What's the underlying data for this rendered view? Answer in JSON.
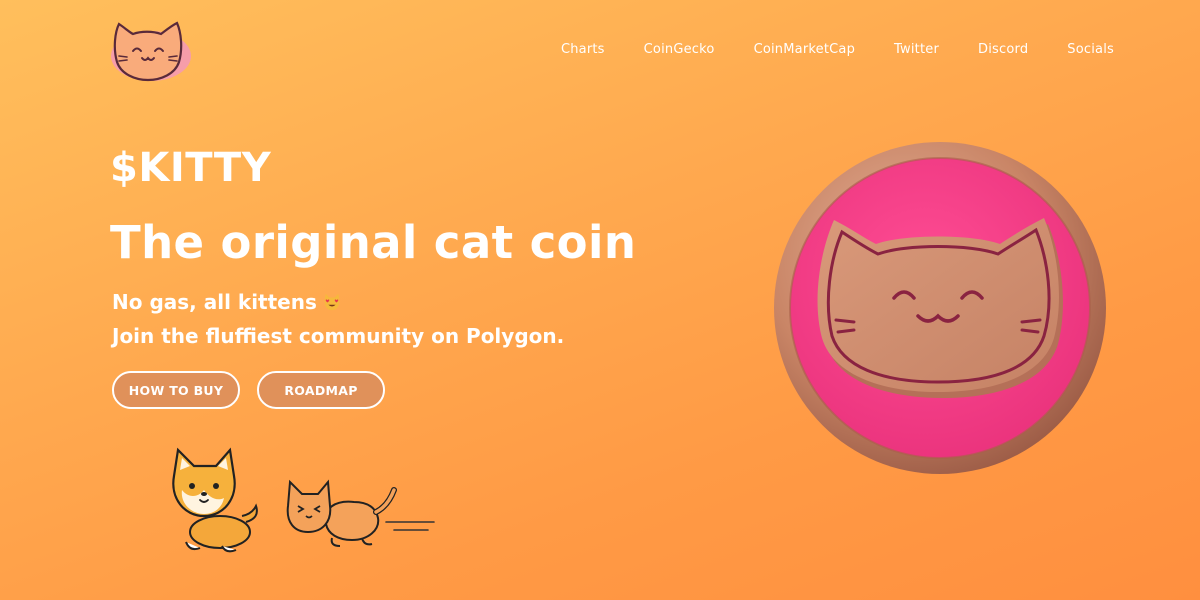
{
  "nav": {
    "items": [
      "Charts",
      "CoinGecko",
      "CoinMarketCap",
      "Twitter",
      "Discord",
      "Socials"
    ]
  },
  "hero": {
    "ticker": "$KITTY",
    "headline": "The original cat coin",
    "subtitle_1": "No gas, all kittens",
    "subtitle_2": "Join the fluffiest community on Polygon."
  },
  "buttons": {
    "how_to_buy": "HOW TO BUY",
    "roadmap": "ROADMAP"
  },
  "colors": {
    "background_start": "#ffbf5c",
    "background_end": "#ff8f3f",
    "coin_pink": "#f43f86",
    "coin_copper": "#cf8e6c",
    "cat_line": "#8a2341"
  }
}
